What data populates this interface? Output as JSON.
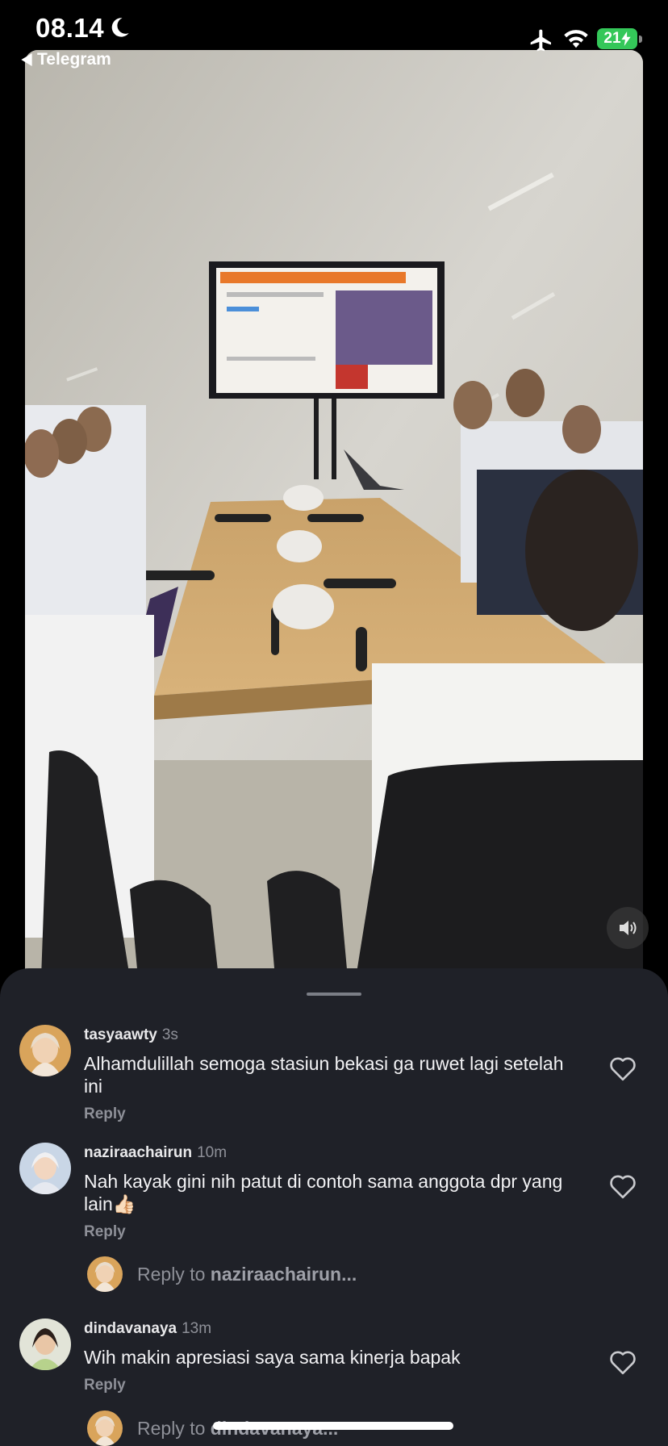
{
  "status_bar": {
    "time": "08.14",
    "battery": "21"
  },
  "back": {
    "label": "Telegram"
  },
  "comments": [
    {
      "username": "tasyaawty",
      "time": "3s",
      "text": "Alhamdulillah semoga stasiun bekasi ga ruwet lagi setelah ini",
      "reply_label": "Reply"
    },
    {
      "username": "naziraachairun",
      "time": "10m",
      "text": "Nah kayak gini nih patut di contoh sama anggota dpr yang lain👍🏻",
      "reply_label": "Reply"
    },
    {
      "username": "dindavanaya",
      "time": "13m",
      "text": "Wih makin apresiasi saya sama kinerja bapak",
      "reply_label": "Reply"
    }
  ],
  "reply_prompts": [
    {
      "prefix": "Reply to",
      "target": "naziraachairun..."
    },
    {
      "prefix": "Reply to",
      "target": "dindavanaya..."
    }
  ]
}
